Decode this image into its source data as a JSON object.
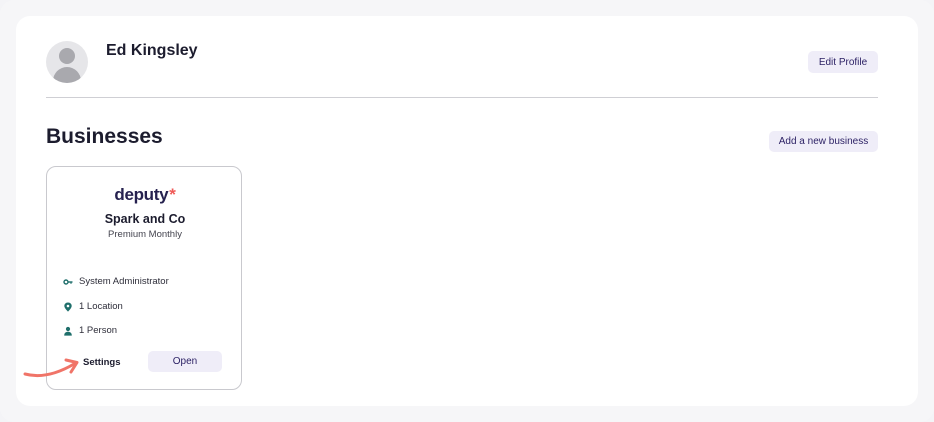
{
  "profile": {
    "name": "Ed Kingsley",
    "edit_label": "Edit Profile"
  },
  "businesses": {
    "title": "Businesses",
    "add_label": "Add a new business",
    "cards": [
      {
        "logo_text": "deputy",
        "logo_mark": "*",
        "name": "Spark and Co",
        "plan": "Premium Monthly",
        "role": "System Administrator",
        "locations": "1 Location",
        "people": "1 Person",
        "settings_label": "Settings",
        "open_label": "Open"
      }
    ]
  },
  "icons": {
    "role": "key-icon",
    "locations": "map-pin-icon",
    "people": "person-icon",
    "annotation": "curved-arrow-icon"
  },
  "colors": {
    "accent_button_bg": "#efedf8",
    "accent_button_text": "#2a1f63",
    "icon_teal": "#1f6f6b",
    "logo_star": "#ef5a57",
    "annotation_arrow": "#f07468"
  }
}
